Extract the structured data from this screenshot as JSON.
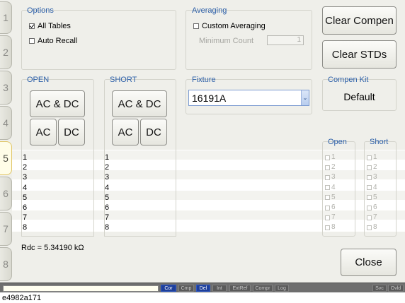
{
  "tabs": [
    "1",
    "2",
    "3",
    "4",
    "5",
    "6",
    "7",
    "8"
  ],
  "active_tab": "5",
  "options": {
    "title": "Options",
    "all_tables": {
      "label": "All Tables",
      "checked": true
    },
    "auto_recall": {
      "label": "Auto Recall",
      "checked": false
    }
  },
  "averaging": {
    "title": "Averaging",
    "custom": {
      "label": "Custom Averaging",
      "checked": false
    },
    "min_count_label": "Minimum Count",
    "min_count_value": "1"
  },
  "buttons": {
    "clear_compen": "Clear Compen",
    "clear_stds": "Clear STDs",
    "close": "Close"
  },
  "open": {
    "title": "OPEN",
    "acdc": "AC & DC",
    "ac": "AC",
    "dc": "DC"
  },
  "short": {
    "title": "SHORT",
    "acdc": "AC & DC",
    "ac": "AC",
    "dc": "DC"
  },
  "fixture": {
    "title": "Fixture",
    "value": "16191A"
  },
  "compen_kit": {
    "title": "Compen Kit",
    "value": "Default"
  },
  "open_col": {
    "title": "Open"
  },
  "short_col": {
    "title": "Short"
  },
  "rows": [
    "1",
    "2",
    "3",
    "4",
    "5",
    "6",
    "7",
    "8"
  ],
  "rdc": "Rdc = 5.34190 kΩ",
  "status": {
    "indicators": [
      "Cor",
      "Cmp",
      "Del",
      "Int",
      "ExtRef",
      "Compr",
      "Log"
    ],
    "active": [
      "Cor",
      "Del"
    ],
    "right": [
      "Svc",
      "Ovld"
    ]
  },
  "caption": "e4982a171"
}
